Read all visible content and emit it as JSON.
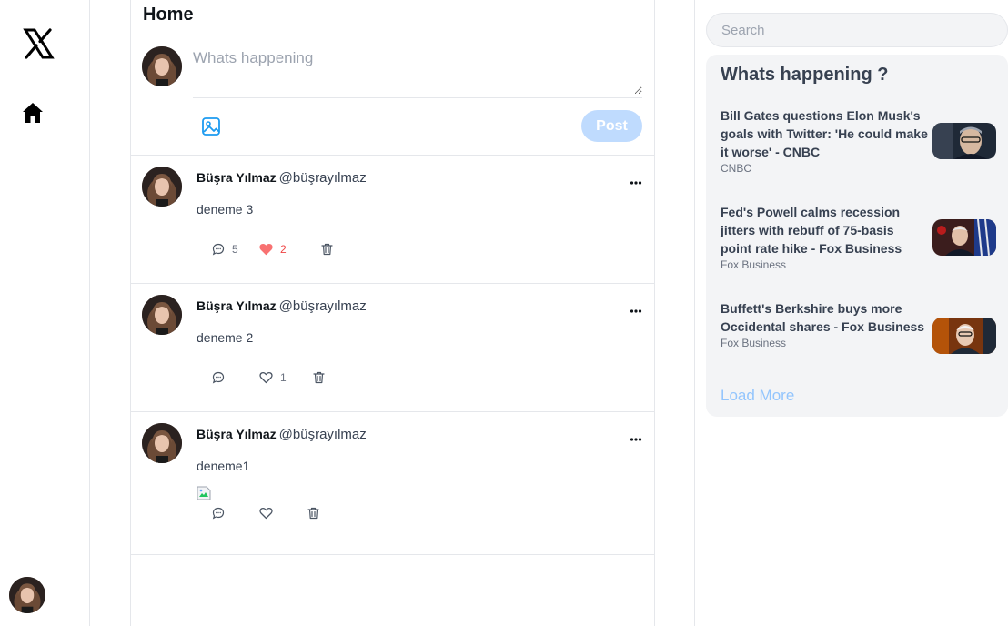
{
  "nav": {
    "logo_icon": "x-logo-icon",
    "home_icon": "home-icon"
  },
  "main": {
    "title": "Home",
    "compose": {
      "placeholder": "Whats happening",
      "post_label": "Post"
    },
    "posts": [
      {
        "name": "Büşra Yılmaz",
        "handle": "@büşrayılmaz",
        "text": "deneme 3",
        "comments": "5",
        "likes": "2",
        "liked": true,
        "has_image": false
      },
      {
        "name": "Büşra Yılmaz",
        "handle": "@büşrayılmaz",
        "text": "deneme 2",
        "comments": "",
        "likes": "1",
        "liked": false,
        "has_image": false
      },
      {
        "name": "Büşra Yılmaz",
        "handle": "@büşrayılmaz",
        "text": "deneme1",
        "comments": "",
        "likes": "",
        "liked": false,
        "has_image": true
      }
    ]
  },
  "right": {
    "search_placeholder": "Search",
    "trends_title": "Whats happening ?",
    "news": [
      {
        "title": "Bill Gates questions Elon Musk's goals with Twitter: 'He could make it worse' - CNBC",
        "source": "CNBC"
      },
      {
        "title": "Fed's Powell calms recession jitters with rebuff of 75-basis point rate hike - Fox Business",
        "source": "Fox Business"
      },
      {
        "title": "Buffett's Berkshire buys more Occidental shares - Fox Business",
        "source": "Fox Business"
      }
    ],
    "load_more": "Load More"
  },
  "colors": {
    "accent": "#1d9bf0",
    "post_button_disabled": "#bfdbfe",
    "like_active": "#ef4444",
    "panel_bg": "#f3f4f6"
  }
}
